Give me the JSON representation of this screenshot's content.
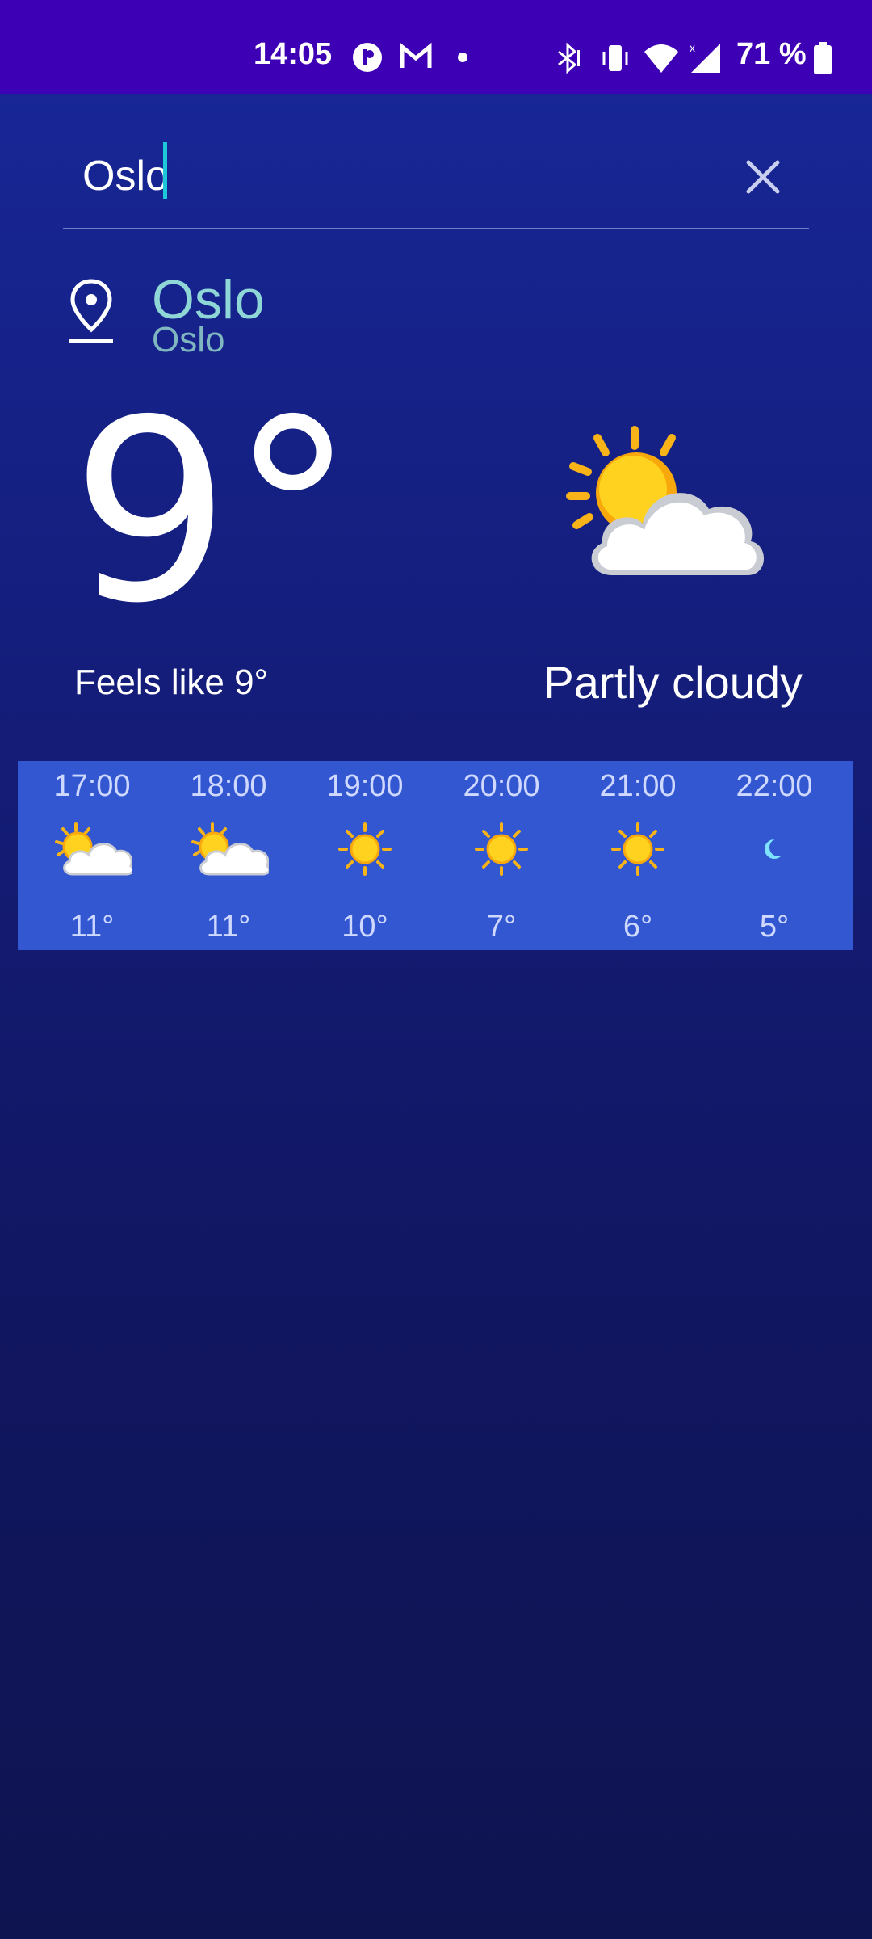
{
  "status_bar": {
    "time": "14:05",
    "battery": "71 %",
    "icons": [
      "media-icon",
      "gmail-icon",
      "dot-icon",
      "bluetooth-icon",
      "vibrate-icon",
      "wifi-icon",
      "signal-icon",
      "battery-icon"
    ]
  },
  "search": {
    "value": "Oslo",
    "clear_icon": "close-icon"
  },
  "location": {
    "name": "Oslo",
    "sub": "Oslo",
    "icon": "location-pin-icon"
  },
  "current": {
    "temperature": "9°",
    "feels_like": "Feels like 9°",
    "condition": "Partly cloudy",
    "icon": "partly-cloudy-icon"
  },
  "hourly": [
    {
      "time": "17:00",
      "temp": "11°",
      "icon": "partly-cloudy-icon"
    },
    {
      "time": "18:00",
      "temp": "11°",
      "icon": "partly-cloudy-icon"
    },
    {
      "time": "19:00",
      "temp": "10°",
      "icon": "sun-icon"
    },
    {
      "time": "20:00",
      "temp": "7°",
      "icon": "sun-icon"
    },
    {
      "time": "21:00",
      "temp": "6°",
      "icon": "sun-icon"
    },
    {
      "time": "22:00",
      "temp": "5°",
      "icon": "moon-icon"
    }
  ],
  "colors": {
    "status_bar": "#3d00b4",
    "background_top": "#18289a",
    "background_bottom": "#0e1450",
    "hourly_strip": "#3257d1",
    "location_text": "#8fd7d7",
    "caret": "#1fc8d8"
  }
}
